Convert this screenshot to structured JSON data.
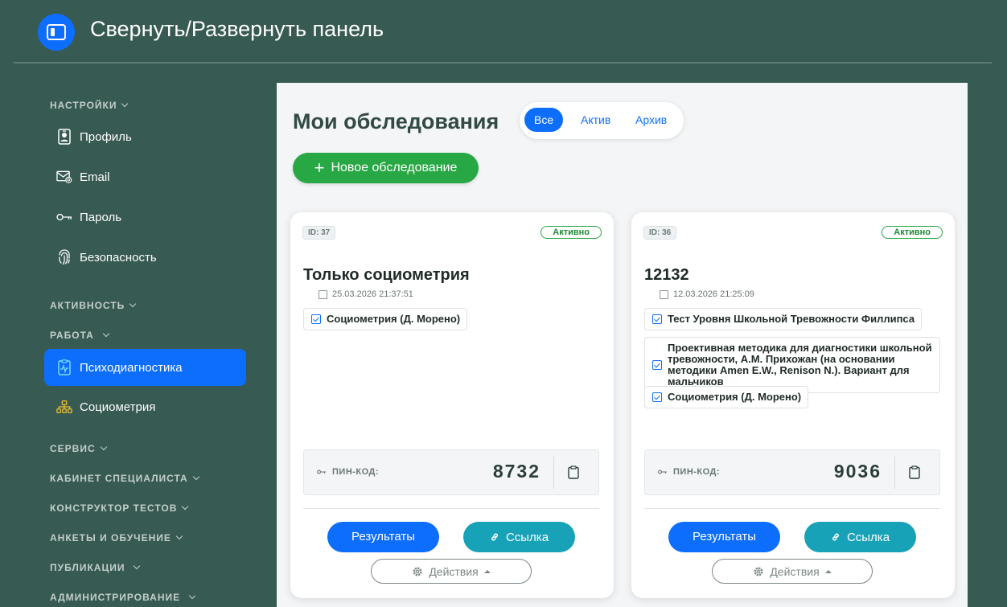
{
  "header": {
    "toggle_label": "Свернуть/Развернуть панель"
  },
  "sidebar": {
    "sections": [
      {
        "label": "НАСТРОЙКИ"
      },
      {
        "label": "АКТИВНОСТЬ"
      },
      {
        "label": "РАБОТА"
      },
      {
        "label": "СЕРВИС"
      },
      {
        "label": "КАБИНЕТ СПЕЦИАЛИСТА"
      },
      {
        "label": "КОНСТРУКТОР ТЕСТОВ"
      },
      {
        "label": "АНКЕТЫ И ОБУЧЕНИЕ"
      },
      {
        "label": "ПУБЛИКАЦИИ"
      },
      {
        "label": "АДМИНИСТРИРОВАНИЕ"
      }
    ],
    "items": [
      {
        "label": "Профиль",
        "icon": "id-badge-icon"
      },
      {
        "label": "Email",
        "icon": "envelope-at-icon"
      },
      {
        "label": "Пароль",
        "icon": "key-icon"
      },
      {
        "label": "Безопасность",
        "icon": "fingerprint-icon"
      },
      {
        "label": "Психодиагностика",
        "icon": "clipboard-pulse-icon",
        "active": true
      },
      {
        "label": "Социометрия",
        "icon": "diagram-icon"
      }
    ]
  },
  "main": {
    "title": "Мои обследования",
    "filters": [
      {
        "label": "Все",
        "active": true
      },
      {
        "label": "Актив"
      },
      {
        "label": "Архив"
      }
    ],
    "new_button": "Новое обследование",
    "cards": [
      {
        "id": "ID: 37",
        "status": "Активно",
        "title": "Только социометрия",
        "date": "25.03.2026 21:37:51",
        "tests": [
          "Социометрия (Д. Морено)"
        ],
        "pin_label": "ПИН-КОД:",
        "pin": "8732",
        "results_label": "Результаты",
        "link_label": "Ссылка",
        "actions_label": "Действия"
      },
      {
        "id": "ID: 36",
        "status": "Активно",
        "title": "12132",
        "date": "12.03.2026 21:25:09",
        "tests": [
          "Тест Уровня Школьной Тревожности Филлипса",
          "Проективная методика для диагностики школьной тревожности, А.М. Прихожан (на основании методики Amen E.W., Renison N.). Вариант для мальчиков",
          "Социометрия (Д. Морено)"
        ],
        "pin_label": "ПИН-КОД:",
        "pin": "9036",
        "results_label": "Результаты",
        "link_label": "Ссылка",
        "actions_label": "Действия"
      }
    ]
  },
  "colors": {
    "background": "#375a52",
    "primary": "#0d6efd",
    "success": "#28a745",
    "info": "#17a2b8"
  }
}
